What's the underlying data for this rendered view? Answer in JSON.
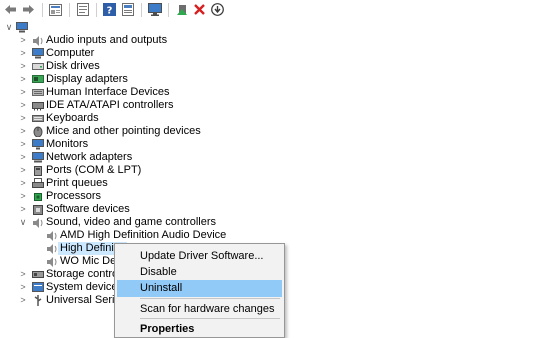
{
  "toolbar": {
    "buttons": [
      {
        "name": "back-arrow-icon"
      },
      {
        "name": "forward-arrow-icon"
      },
      {
        "name": "properties-panel-icon"
      },
      {
        "name": "driver-sheet-icon"
      },
      {
        "name": "help-icon"
      },
      {
        "name": "view-sheet-icon"
      },
      {
        "name": "display-monitor-icon"
      },
      {
        "name": "update-driver-icon"
      },
      {
        "name": "uninstall-x-icon",
        "color": "#d42020"
      },
      {
        "name": "download-arrow-icon"
      }
    ]
  },
  "tree": {
    "root_expander": "∨",
    "categories": [
      {
        "label": "Audio inputs and outputs",
        "icon": "speaker-icon"
      },
      {
        "label": "Computer",
        "icon": "computer-icon"
      },
      {
        "label": "Disk drives",
        "icon": "disk-drive-icon"
      },
      {
        "label": "Display adapters",
        "icon": "display-adapter-icon"
      },
      {
        "label": "Human Interface Devices",
        "icon": "hid-icon"
      },
      {
        "label": "IDE ATA/ATAPI controllers",
        "icon": "ide-controller-icon"
      },
      {
        "label": "Keyboards",
        "icon": "keyboard-icon"
      },
      {
        "label": "Mice and other pointing devices",
        "icon": "mouse-icon"
      },
      {
        "label": "Monitors",
        "icon": "monitor-icon"
      },
      {
        "label": "Network adapters",
        "icon": "network-adapter-icon"
      },
      {
        "label": "Ports (COM & LPT)",
        "icon": "port-icon"
      },
      {
        "label": "Print queues",
        "icon": "printer-icon"
      },
      {
        "label": "Processors",
        "icon": "processor-icon"
      },
      {
        "label": "Software devices",
        "icon": "software-device-icon"
      },
      {
        "label": "Sound, video and game controllers",
        "icon": "sound-controller-icon",
        "expanded": true
      }
    ],
    "sound_children": [
      {
        "label": "AMD High Definition Audio Device",
        "icon": "speaker-icon"
      },
      {
        "label": "High Definitio",
        "icon": "speaker-icon",
        "selected": true
      },
      {
        "label": "WO Mic Devic",
        "icon": "speaker-icon"
      }
    ],
    "after_categories": [
      {
        "label": "Storage controller",
        "icon": "storage-controller-icon"
      },
      {
        "label": "System devices",
        "icon": "system-device-icon"
      },
      {
        "label": "Universal Serial Bu",
        "icon": "usb-icon"
      }
    ],
    "expander_collapsed": ">",
    "expander_expanded": "∨"
  },
  "context_menu": {
    "items": [
      {
        "label": "Update Driver Software..."
      },
      {
        "label": "Disable"
      },
      {
        "label": "Uninstall",
        "highlighted": true
      },
      {
        "label": "Scan for hardware changes"
      },
      {
        "label": "Properties",
        "bold": true
      }
    ],
    "highlight_color": "#91c9f7"
  }
}
